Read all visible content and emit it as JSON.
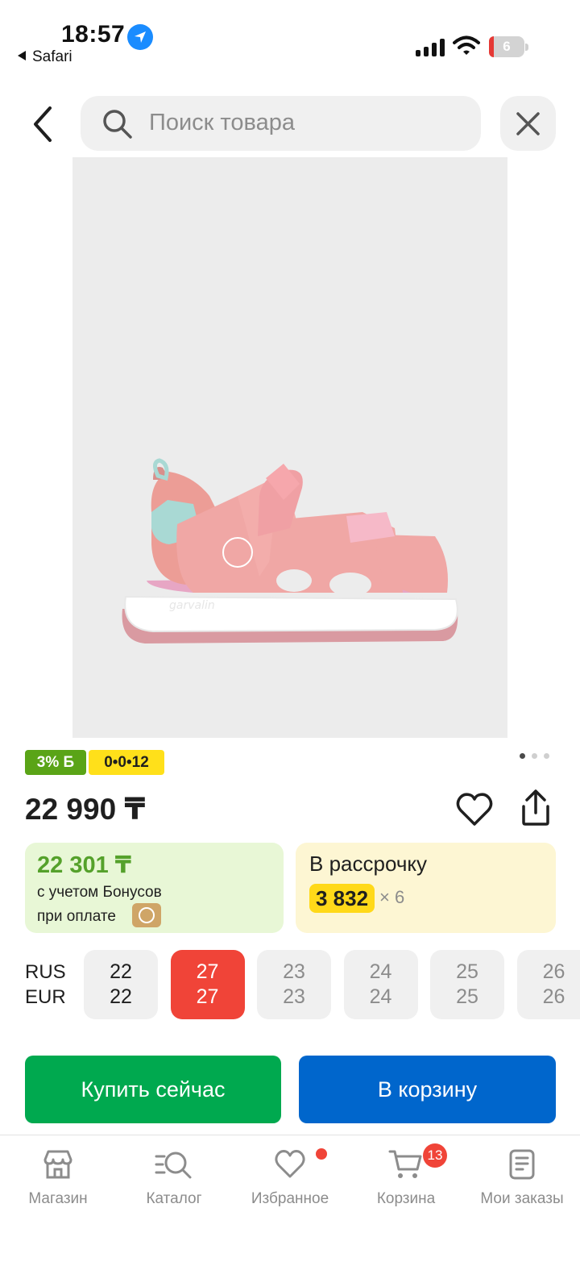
{
  "status_bar": {
    "time": "18:57",
    "back_to_app": "Safari",
    "battery_level": "6"
  },
  "header": {
    "search_placeholder": "Поиск товара"
  },
  "product": {
    "badge_bonus": "3% Б",
    "badge_installment": "0•0•12",
    "gallery_page_count": 3,
    "gallery_active_page": 1,
    "price": "22 990 ₸"
  },
  "bonus_card": {
    "amount": "22 301 ₸",
    "line1": "с учетом Бонусов",
    "line2": "при оплате"
  },
  "installment_card": {
    "label": "В рассрочку",
    "monthly": "3 832",
    "months": "× 6"
  },
  "sizes": {
    "label_rus": "RUS",
    "label_eur": "EUR",
    "items": [
      {
        "rus": "22",
        "eur": "22",
        "state": "available"
      },
      {
        "rus": "27",
        "eur": "27",
        "state": "selected"
      },
      {
        "rus": "23",
        "eur": "23",
        "state": "unavailable"
      },
      {
        "rus": "24",
        "eur": "24",
        "state": "unavailable"
      },
      {
        "rus": "25",
        "eur": "25",
        "state": "unavailable"
      },
      {
        "rus": "26",
        "eur": "26",
        "state": "unavailable"
      }
    ]
  },
  "actions": {
    "buy_now": "Купить сейчас",
    "add_to_cart": "В корзину"
  },
  "tabbar": {
    "items": [
      {
        "label": "Магазин",
        "icon": "shop-icon"
      },
      {
        "label": "Каталог",
        "icon": "catalog-search-icon"
      },
      {
        "label": "Избранное",
        "icon": "heart-icon"
      },
      {
        "label": "Корзина",
        "icon": "cart-icon",
        "badge": "13"
      },
      {
        "label": "Мои заказы",
        "icon": "orders-icon"
      }
    ]
  },
  "colors": {
    "buy_button": "#00a94f",
    "cart_button": "#0066cc",
    "selected_size": "#f04438",
    "bonus_green": "#55a12b",
    "installment_yellow": "#ffd919",
    "badge_red": "#f04438"
  }
}
